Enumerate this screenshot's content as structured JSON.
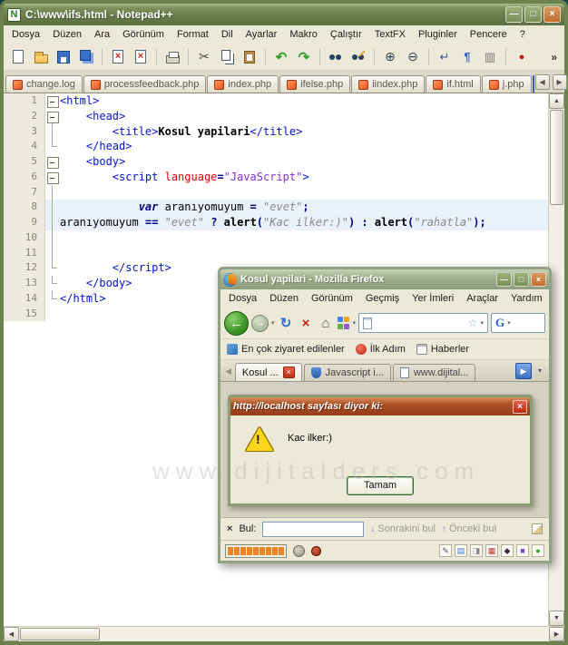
{
  "watermark": "www.dijitalders.com",
  "notepad": {
    "title": "C:\\www\\ifs.html - Notepad++",
    "app_icon_letter": "N",
    "window_buttons": {
      "minimize": "—",
      "maximize": "□",
      "close": "×"
    },
    "menu": [
      "Dosya",
      "Düzen",
      "Ara",
      "Görünüm",
      "Format",
      "Dil",
      "Ayarlar",
      "Makro",
      "Çalıştır",
      "TextFX",
      "Pluginler",
      "Pencere",
      "?"
    ],
    "toolbar": [
      {
        "name": "new-file"
      },
      {
        "name": "open-file"
      },
      {
        "name": "save"
      },
      {
        "name": "save-all"
      },
      {
        "sep": true
      },
      {
        "name": "close",
        "glyph": "×"
      },
      {
        "name": "close-all",
        "glyph": "×"
      },
      {
        "sep": true
      },
      {
        "name": "print"
      },
      {
        "sep": true
      },
      {
        "name": "cut",
        "glyph": "✂"
      },
      {
        "name": "copy"
      },
      {
        "name": "paste"
      },
      {
        "sep": true
      },
      {
        "name": "undo",
        "glyph": "↶"
      },
      {
        "name": "redo",
        "glyph": "↷"
      },
      {
        "sep": true
      },
      {
        "name": "find"
      },
      {
        "name": "replace"
      },
      {
        "sep": true
      },
      {
        "name": "zoom-in",
        "glyph": "⊕"
      },
      {
        "name": "zoom-out",
        "glyph": "⊖"
      },
      {
        "sep": true
      },
      {
        "name": "word-wrap",
        "glyph": "↵"
      },
      {
        "name": "show-all-chars",
        "glyph": "¶"
      },
      {
        "name": "indent-guide",
        "glyph": "▥"
      },
      {
        "sep": true
      },
      {
        "name": "macro-record",
        "glyph": "●"
      }
    ],
    "toolbar_overflow": "»",
    "tabs": [
      {
        "label": "change.log"
      },
      {
        "label": "processfeedback.php"
      },
      {
        "label": "index.php"
      },
      {
        "label": "ifelse.php"
      },
      {
        "label": "iindex.php"
      },
      {
        "label": "if.html"
      },
      {
        "label": "j.php"
      }
    ],
    "tabbar": {
      "scroll_left": "◀",
      "scroll_right": "▶"
    },
    "scrollbar": {
      "up": "▲",
      "down": "▼",
      "left": "◀",
      "right": "▶"
    },
    "editor": {
      "lines": [
        {
          "n": "1",
          "fold": "box",
          "tokens": [
            {
              "t": "<html>",
              "c": "tag"
            }
          ]
        },
        {
          "n": "2",
          "fold": "box",
          "tokens": [
            {
              "t": "    ",
              "c": "pl"
            },
            {
              "t": "<head>",
              "c": "tag"
            }
          ]
        },
        {
          "n": "3",
          "fold": "v",
          "tokens": [
            {
              "t": "        ",
              "c": "pl"
            },
            {
              "t": "<title>",
              "c": "tag"
            },
            {
              "t": "Kosul yapilari",
              "c": "bt"
            },
            {
              "t": "</title>",
              "c": "tag"
            }
          ]
        },
        {
          "n": "4",
          "fold": "end",
          "tokens": [
            {
              "t": "    ",
              "c": "pl"
            },
            {
              "t": "</head>",
              "c": "tag"
            }
          ]
        },
        {
          "n": "5",
          "fold": "box",
          "tokens": [
            {
              "t": "    ",
              "c": "pl"
            },
            {
              "t": "<body>",
              "c": "tag"
            }
          ]
        },
        {
          "n": "6",
          "fold": "box",
          "tokens": [
            {
              "t": "        ",
              "c": "pl"
            },
            {
              "t": "<script ",
              "c": "tag"
            },
            {
              "t": "language",
              "c": "attr"
            },
            {
              "t": "=",
              "c": "op"
            },
            {
              "t": "\"JavaScript\"",
              "c": "val"
            },
            {
              "t": ">",
              "c": "tag"
            }
          ]
        },
        {
          "n": "7",
          "fold": "v",
          "tokens": []
        },
        {
          "n": "8",
          "fold": "v",
          "hl": true,
          "tokens": [
            {
              "t": "            ",
              "c": "pl"
            },
            {
              "t": "var",
              "c": "kw"
            },
            {
              "t": " aranıyomuyum ",
              "c": "pl"
            },
            {
              "t": "=",
              "c": "op"
            },
            {
              "t": " ",
              "c": "pl"
            },
            {
              "t": "\"evet\"",
              "c": "str"
            },
            {
              "t": ";",
              "c": "op"
            }
          ]
        },
        {
          "n": "9",
          "fold": "v",
          "hl": true,
          "tokens": [
            {
              "t": "aranıyomuyum ",
              "c": "pl"
            },
            {
              "t": "==",
              "c": "op"
            },
            {
              "t": " ",
              "c": "pl"
            },
            {
              "t": "\"evet\"",
              "c": "str"
            },
            {
              "t": " ",
              "c": "pl"
            },
            {
              "t": "?",
              "c": "op"
            },
            {
              "t": " ",
              "c": "pl"
            },
            {
              "t": "alert",
              "c": "fn"
            },
            {
              "t": "(",
              "c": "op"
            },
            {
              "t": "\"Kac ilker:)\"",
              "c": "str"
            },
            {
              "t": ")",
              "c": "op"
            },
            {
              "t": " ",
              "c": "pl"
            },
            {
              "t": ":",
              "c": "op"
            },
            {
              "t": " ",
              "c": "pl"
            },
            {
              "t": "alert",
              "c": "fn"
            },
            {
              "t": "(",
              "c": "op"
            },
            {
              "t": "\"rahatla\"",
              "c": "str"
            },
            {
              "t": ")",
              "c": "op"
            },
            {
              "t": ";",
              "c": "op"
            }
          ]
        },
        {
          "n": "10",
          "fold": "v",
          "tokens": []
        },
        {
          "n": "11",
          "fold": "v",
          "tokens": []
        },
        {
          "n": "12",
          "fold": "end",
          "tokens": [
            {
              "t": "        ",
              "c": "pl"
            },
            {
              "t": "</script>",
              "c": "tag"
            }
          ]
        },
        {
          "n": "13",
          "fold": "end",
          "tokens": [
            {
              "t": "    ",
              "c": "pl"
            },
            {
              "t": "</body>",
              "c": "tag"
            }
          ]
        },
        {
          "n": "14",
          "fold": "end",
          "tokens": [
            {
              "t": "</html>",
              "c": "tag"
            }
          ]
        },
        {
          "n": "15",
          "fold": "",
          "tokens": []
        }
      ]
    }
  },
  "firefox": {
    "title": "Kosul yapilari - Mozilla Firefox",
    "window_buttons": {
      "minimize": "—",
      "maximize": "□",
      "close": "×"
    },
    "menu": [
      "Dosya",
      "Düzen",
      "Görünüm",
      "Geçmiş",
      "Yer İmleri",
      "Araçlar",
      "Yardım"
    ],
    "nav": {
      "back": "←",
      "forward": "→",
      "dropdown": "▾",
      "refresh": "↻",
      "stop": "×",
      "home": "⌂",
      "star": "☆",
      "search_logo": "G"
    },
    "address_value": "",
    "bookmarks": [
      {
        "label": "En çok ziyaret edilenler",
        "icon": "most-visited-icon"
      },
      {
        "label": "İlk Adım",
        "icon": "ilk-adim-icon"
      },
      {
        "label": "Haberler",
        "icon": "news-icon"
      }
    ],
    "tabs": [
      {
        "label": "Kosul ...",
        "active": true,
        "close": true
      },
      {
        "label": "Javascript i...",
        "icon": "shield"
      },
      {
        "label": "www.dijital...",
        "icon": "doc"
      }
    ],
    "tabbar": {
      "scroll_left": "◀",
      "scroll_right": "▶",
      "list": "▾"
    },
    "findbar": {
      "close": "×",
      "label": "Bul:",
      "value": "",
      "next": "Sonrakini bul",
      "prev": "Önceki bul",
      "down": "↓",
      "up": "↑"
    },
    "statusbar": {
      "progress_blocks": 9,
      "progress_color": "#F58220",
      "addons": [
        {
          "name": "pencil-icon",
          "glyph": "✎",
          "color": "#555555"
        },
        {
          "name": "palette-icon",
          "glyph": "▤",
          "color": "#3A76C8"
        },
        {
          "name": "window-icon",
          "glyph": "◨",
          "color": "#8A8A8A"
        },
        {
          "name": "grid-icon",
          "glyph": "▦",
          "color": "#C03030"
        },
        {
          "name": "diamond-icon",
          "glyph": "◆",
          "color": "#333333"
        },
        {
          "name": "square-icon",
          "glyph": "■",
          "color": "#7A4AC8"
        },
        {
          "name": "status-ok-icon",
          "glyph": "●",
          "color": "#2FA32F"
        }
      ]
    }
  },
  "alert": {
    "title": "http://localhost sayfası diyor ki:",
    "close": "×",
    "warn_glyph": "!",
    "message": "Kac ilker:)",
    "button": "Tamam"
  }
}
